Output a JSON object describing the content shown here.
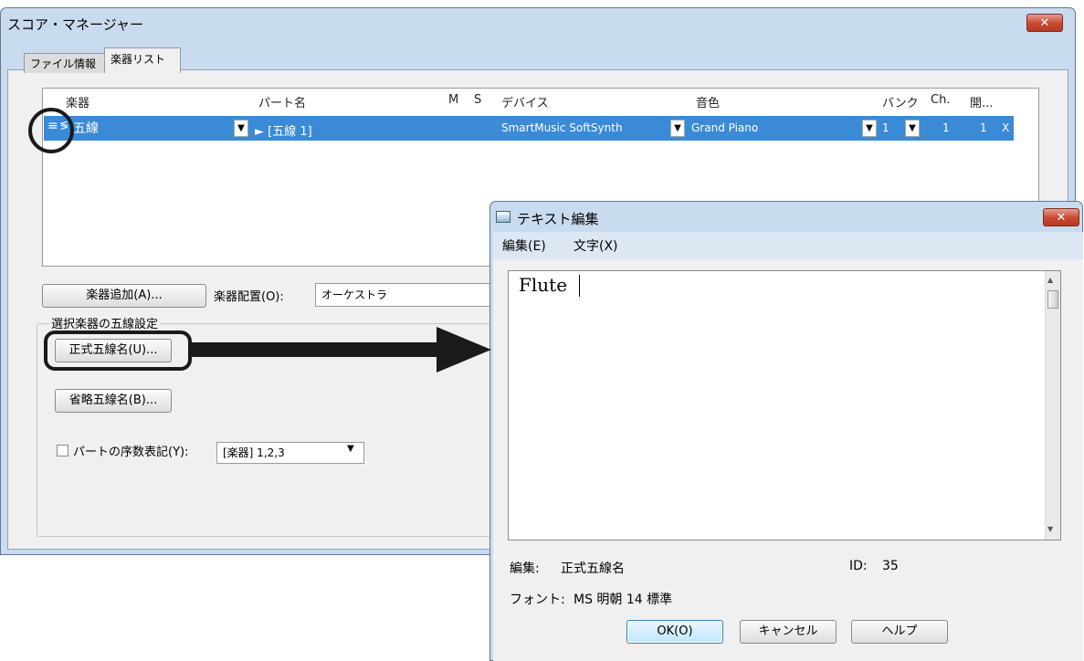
{
  "main_window": {
    "title": "スコア・マネージャー",
    "close_glyph": "✕",
    "tabs": [
      "ファイル情報",
      "楽器リスト"
    ],
    "grid": {
      "headers": [
        "楽器",
        "パート名",
        "M",
        "S",
        "デバイス",
        "音色",
        "バンク",
        "Ch.",
        "開..."
      ],
      "row": {
        "handle": "≡",
        "icon": "≶",
        "instrument": "五線",
        "part_name": "► [五線 1]",
        "device": "SmartMusic SoftSynth",
        "tone": "Grand Piano",
        "bank": "1",
        "ch": "1",
        "open": "1",
        "extra": "X"
      }
    },
    "add_instrument_button": "楽器追加(A)...",
    "layout_label": "楽器配置(O):",
    "layout_value": "オーケストラ",
    "group_title": "選択楽器の五線設定",
    "full_name_button": "正式五線名(U)...",
    "abbr_name_button": "省略五線名(B)...",
    "ordinal_checkbox_label": "パートの序数表記(Y):",
    "ordinal_value": "[楽器] 1,2,3"
  },
  "text_dialog": {
    "title": "テキスト編集",
    "close_glyph": "✕",
    "menu": [
      "編集(E)",
      "文字(X)"
    ],
    "content": "Flute",
    "edit_label": "編集:",
    "edit_value": "正式五線名",
    "id_label": "ID:",
    "id_value": "35",
    "font_label": "フォント:",
    "font_value": "MS 明朝 14 標準",
    "ok_button": "OK(O)",
    "cancel_button": "キャンセル",
    "help_button": "ヘルプ"
  },
  "colors": {
    "titlebar": "#c9dbee",
    "selection": "#3b8ad6",
    "close_button": "#c8472f",
    "annotation": "#1a1a1a"
  }
}
